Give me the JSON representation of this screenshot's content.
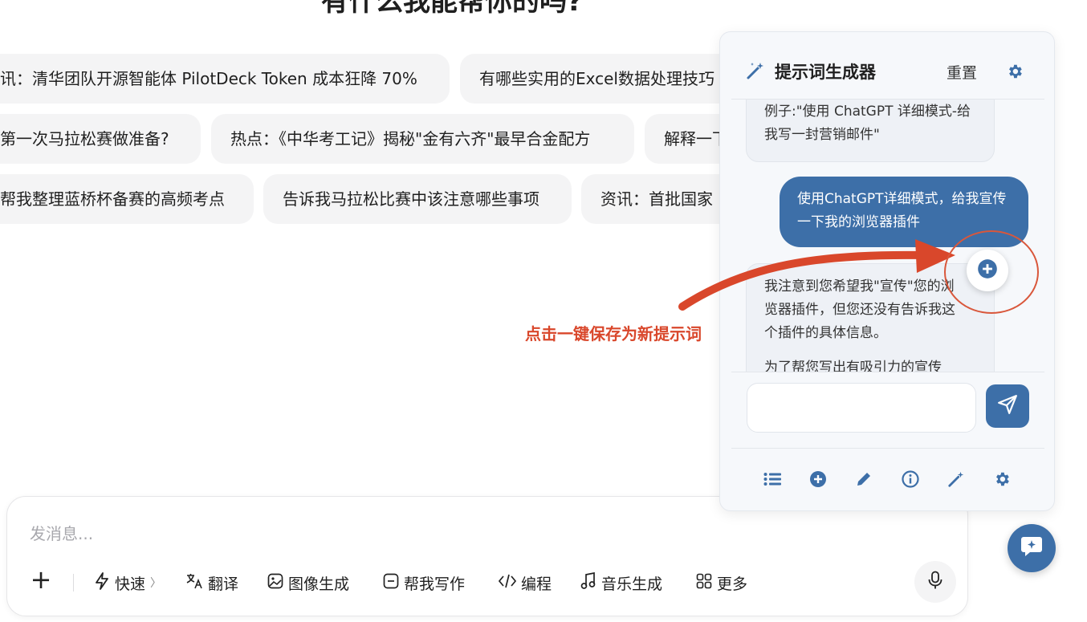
{
  "page": {
    "heading": "有什么我能帮你的吗?"
  },
  "suggestions": {
    "row1": [
      "讯：清华团队开源智能体 PilotDeck Token 成本狂降 70%",
      "有哪些实用的Excel数据处理技巧"
    ],
    "row2": [
      "第一次马拉松赛做准备?",
      "热点：《中华考工记》揭秘\"金有六齐\"最早合金配方",
      "解释一下"
    ],
    "row3": [
      "帮我整理蓝桥杯备赛的高频考点",
      "告诉我马拉松比赛中该注意哪些事项",
      "资讯：首批国家"
    ]
  },
  "composer": {
    "placeholder": "发消息...",
    "tools": [
      {
        "icon": "lightning-icon",
        "label": "快速",
        "suffix": "〉"
      },
      {
        "icon": "translate-icon",
        "label": "翻译"
      },
      {
        "icon": "image-icon",
        "label": "图像生成"
      },
      {
        "icon": "writing-icon",
        "label": "帮我写作"
      },
      {
        "icon": "code-icon",
        "label": "编程"
      },
      {
        "icon": "music-icon",
        "label": "音乐生成"
      },
      {
        "icon": "grid-icon",
        "label": "更多"
      }
    ]
  },
  "prompt_panel": {
    "title": "提示词生成器",
    "reset_label": "重置",
    "messages": {
      "example": "例子:\"使用 ChatGPT 详细模式-给我写一封营销邮件\"",
      "user": "使用ChatGPT详细模式，给我宣传一下我的浏览器插件",
      "reply_p1": "我注意到您希望我\"宣传\"您的浏览器插件，但您还没有告诉我这个插件的具体信息。",
      "reply_p2": "为了帮您写出有吸引力的宣传"
    },
    "input_value": "",
    "bottom_icons": [
      "list-icon",
      "plus-circle-icon",
      "pencil-icon",
      "info-icon",
      "magic-wand-icon",
      "gear-icon"
    ]
  },
  "annotation": {
    "label": "点击一键保存为新提示词",
    "color": "#d9472b"
  },
  "colors": {
    "accent": "#3d6fa8",
    "chip_bg": "#f4f4f5",
    "annotation": "#d9472b"
  }
}
